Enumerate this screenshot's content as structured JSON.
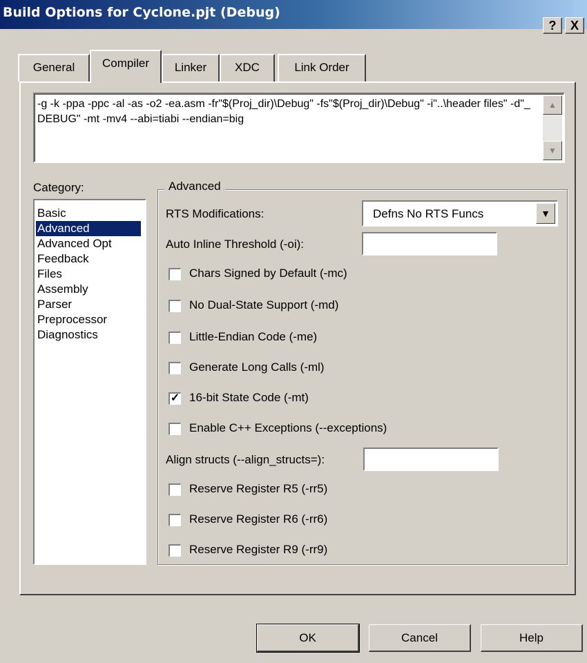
{
  "window": {
    "title": "Build Options for Cyclone.pjt (Debug)",
    "help_label": "?",
    "close_label": "X"
  },
  "tabs": [
    {
      "label": "General",
      "active": false
    },
    {
      "label": "Compiler",
      "active": true
    },
    {
      "label": "Linker",
      "active": false
    },
    {
      "label": "XDC",
      "active": false
    },
    {
      "label": "Link Order",
      "active": false
    }
  ],
  "command_line": "-g -k -ppa -ppc -al -as -o2 -ea.asm -fr\"$(Proj_dir)\\Debug\" -fs\"$(Proj_dir)\\Debug\" -i\"..\\header files\" -d\"_DEBUG\" -mt -mv4 --abi=tiabi --endian=big",
  "category": {
    "label": "Category:",
    "items": [
      "Basic",
      "Advanced",
      "Advanced Opt",
      "Feedback",
      "Files",
      "Assembly",
      "Parser",
      "Preprocessor",
      "Diagnostics"
    ],
    "selected": "Advanced"
  },
  "advanced": {
    "group_label": "Advanced",
    "rts_label": "RTS Modifications:",
    "rts_value": "Defns No RTS Funcs",
    "inline_label": "Auto Inline Threshold (-oi):",
    "inline_value": "",
    "align_label": "Align structs (--align_structs=):",
    "align_value": "",
    "options": [
      {
        "label": "Chars Signed by Default (-mc)",
        "checked": false
      },
      {
        "label": "No Dual-State Support (-md)",
        "checked": false
      },
      {
        "label": "Little-Endian Code (-me)",
        "checked": false
      },
      {
        "label": "Generate Long Calls (-ml)",
        "checked": false
      },
      {
        "label": "16-bit State Code (-mt)",
        "checked": true
      },
      {
        "label": "Enable C++ Exceptions (--exceptions)",
        "checked": false
      },
      {
        "label": "Reserve Register R5 (-rr5)",
        "checked": false
      },
      {
        "label": "Reserve Register R6 (-rr6)",
        "checked": false
      },
      {
        "label": "Reserve Register R9 (-rr9)",
        "checked": false
      }
    ]
  },
  "buttons": {
    "ok": "OK",
    "cancel": "Cancel",
    "help": "Help"
  },
  "colors": {
    "title_bar": "#0a246a",
    "selection": "#0a246a",
    "face": "#d4d0c8"
  }
}
